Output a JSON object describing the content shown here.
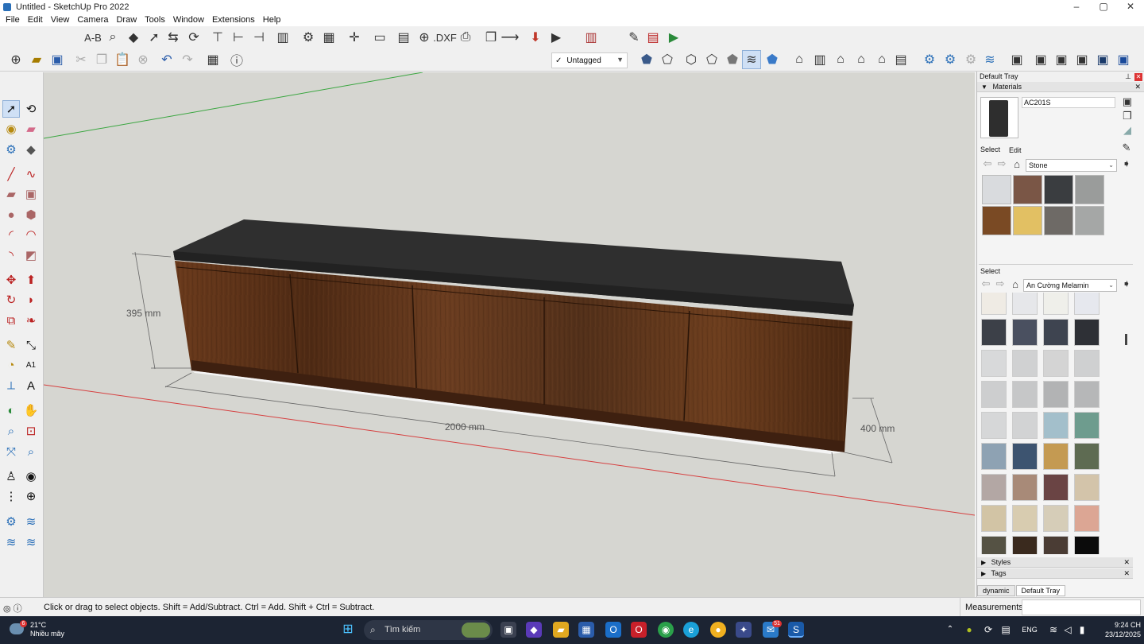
{
  "window": {
    "title": "Untitled - SketchUp Pro 2022",
    "controls": [
      "–",
      "▢",
      "✕"
    ]
  },
  "menu": [
    "File",
    "Edit",
    "View",
    "Camera",
    "Draw",
    "Tools",
    "Window",
    "Extensions",
    "Help"
  ],
  "toolbar": {
    "dxf_label": ".DXF",
    "ab_label": "A-B",
    "tag_value": "Untagged",
    "tag_check": "✓"
  },
  "canvas": {
    "dim_height": "395 mm",
    "dim_length": "2000 mm",
    "dim_depth": "400 mm"
  },
  "tray": {
    "title": "Default Tray",
    "materials_header": "Materials",
    "material_name": "AC201S",
    "tab_select": "Select",
    "tab_edit": "Edit",
    "library1": "Stone",
    "select_label": "Select",
    "library2": "An Cường Melamin",
    "styles_header": "Styles",
    "tags_header": "Tags",
    "stone_colors": [
      "#d9dbde",
      "#7a5646",
      "#3a3d40",
      "#9a9c9b",
      "#7a4a24",
      "#e2c063",
      "#6e6a66",
      "#a5a7a6"
    ],
    "melamin_colors": [
      [
        "#efebe4",
        "#e6e7ea",
        "#efefea",
        "#e6e8ee"
      ],
      [
        "#3c4048",
        "#4a5060",
        "#3e4450",
        "#2e3036"
      ],
      [
        "#d8d9da",
        "#d0d1d2",
        "#d4d4d4",
        "#cfd0d1"
      ],
      [
        "#cdcecf",
        "#c6c7c8",
        "#b2b3b4",
        "#b6b7b8"
      ],
      [
        "#d6d7d8",
        "#d2d3d4",
        "#a3bfcb",
        "#6e9c8e"
      ],
      [
        "#8ea2b3",
        "#3d5470",
        "#c49a52",
        "#5e6b52"
      ],
      [
        "#b3a7a4",
        "#a88a78",
        "#6a4444",
        "#d3c4aa"
      ],
      [
        "#d2c4a5",
        "#d8ccb0",
        "#d6cdb8",
        "#dca694"
      ],
      [
        "#555244",
        "#3a2a1e",
        "#4a3c34",
        "#0b0b0b"
      ]
    ],
    "tabs": [
      "dynamic",
      "Default Tray"
    ]
  },
  "status": {
    "text": "Click or drag to select objects. Shift = Add/Subtract. Ctrl = Add. Shift + Ctrl = Subtract.",
    "measurements_label": "Measurements"
  },
  "taskbar": {
    "temperature": "21°C",
    "weather": "Nhiều mây",
    "weather_badge": "6",
    "search_placeholder": "Tìm kiếm",
    "lang": "ENG",
    "time": "9:24 CH",
    "date": "23/12/2025",
    "mail_badge": "51"
  }
}
